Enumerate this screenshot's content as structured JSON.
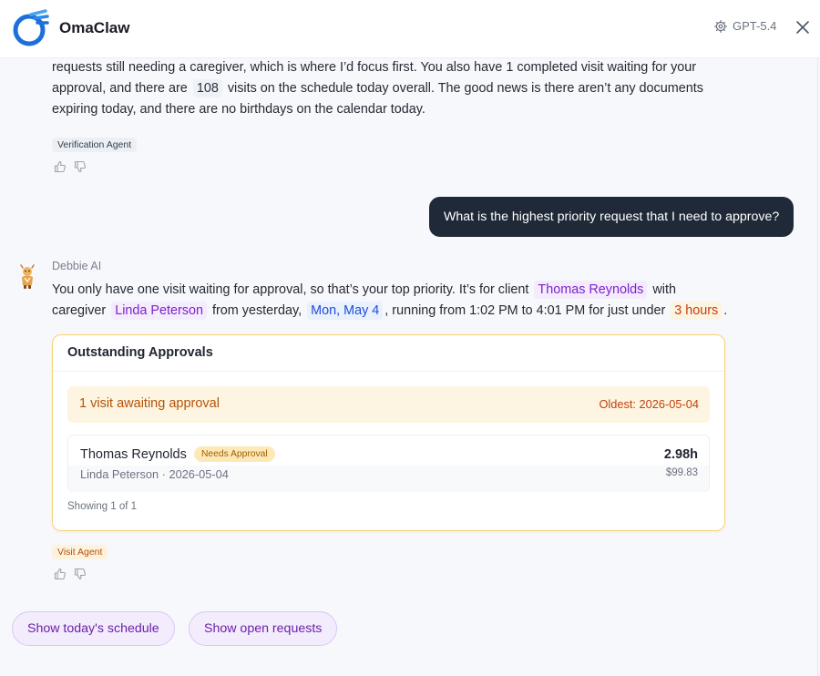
{
  "header": {
    "app_title": "OmaClaw",
    "model": "GPT-5.4"
  },
  "previous_message": {
    "line1": "requests still needing a caregiver, which is where I’d focus first. You also have 1 completed visit waiting for your",
    "line2_pre": "approval, and there are",
    "visits_today": "108",
    "line2_post": "visits on the schedule today overall. The good news is there aren’t any documents",
    "line3": "expiring today, and there are no birthdays on the calendar today.",
    "agent_tag": "Verification Agent"
  },
  "user_message": "What is the highest priority request that I need to approve?",
  "bot_reply": {
    "sender": "Debbie AI",
    "t1": "You only have one visit waiting for approval, so that’s your top priority. It’s for client",
    "client": "Thomas Reynolds",
    "t2": "with",
    "t3": "caregiver",
    "caregiver": "Linda Peterson",
    "t4": "from yesterday,",
    "date": "Mon, May 4",
    "t5": ", running from 1:02 PM to 4:01 PM for just under",
    "duration": "3 hours",
    "t6": ".",
    "agent_tag": "Visit Agent"
  },
  "approvals_card": {
    "title": "Outstanding Approvals",
    "banner_title": "1 visit awaiting approval",
    "banner_oldest": "Oldest: 2026-05-04",
    "rows": [
      {
        "client": "Thomas Reynolds",
        "status": "Needs Approval",
        "subtitle": "Linda Peterson · 2026-05-04",
        "hours": "2.98h",
        "amount": "$99.83"
      }
    ],
    "footer": "Showing 1 of 1"
  },
  "suggestions": [
    {
      "label": "Show today's schedule"
    },
    {
      "label": "Show open requests"
    }
  ],
  "colors": {
    "accent_purple": "#7e22ce",
    "approval_amber": "#b45309",
    "user_bubble": "#1f2937"
  }
}
